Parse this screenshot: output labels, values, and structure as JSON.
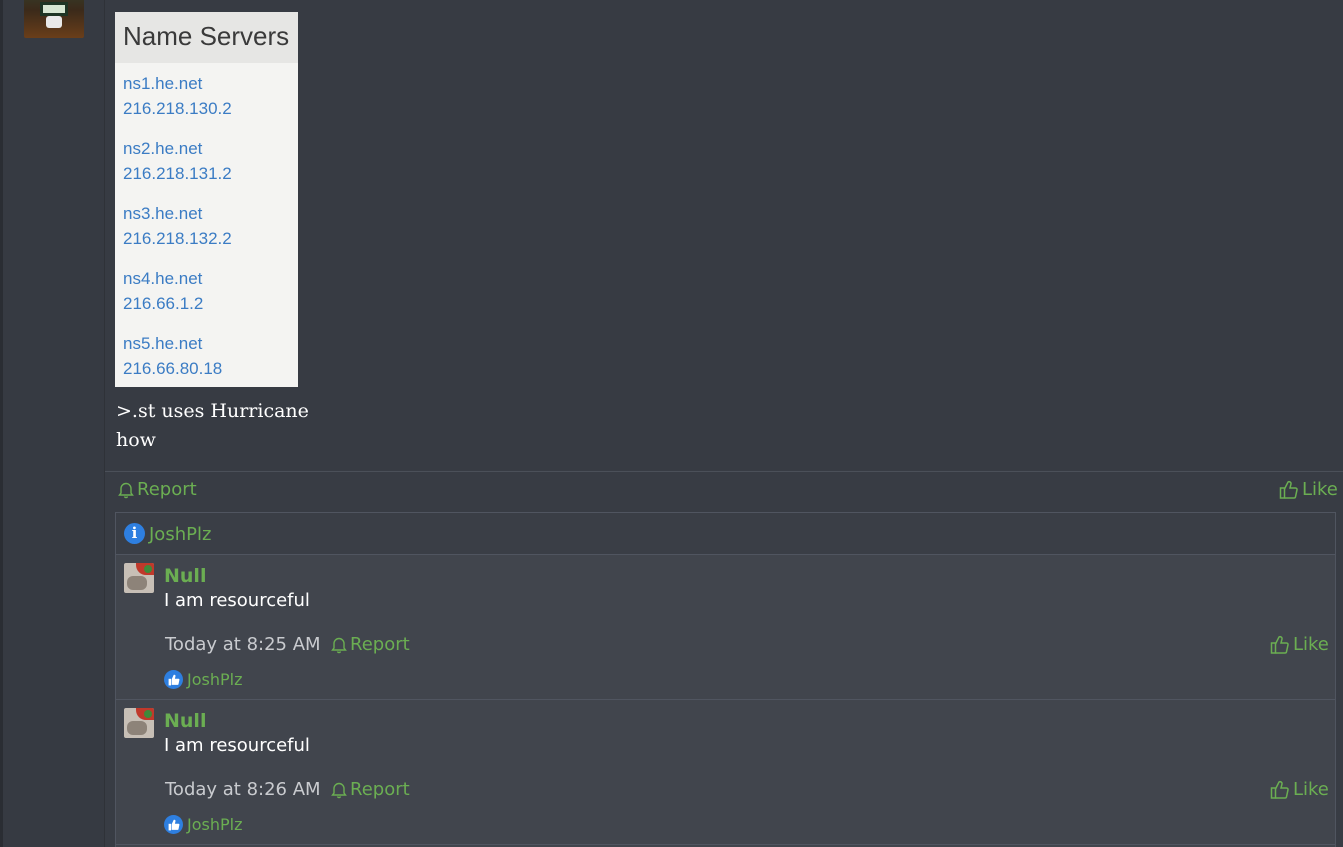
{
  "name_servers": {
    "header": "Name Servers",
    "entries": [
      {
        "host": "ns1.he.net",
        "ip": "216.218.130.2"
      },
      {
        "host": "ns2.he.net",
        "ip": "216.218.131.2"
      },
      {
        "host": "ns3.he.net",
        "ip": "216.218.132.2"
      },
      {
        "host": "ns4.he.net",
        "ip": "216.66.1.2"
      },
      {
        "host": "ns5.he.net",
        "ip": "216.66.80.18"
      }
    ]
  },
  "post": {
    "lines": [
      ">.st uses Hurricane",
      "how"
    ]
  },
  "post_actions": {
    "report_label": "Report",
    "like_label": "Like"
  },
  "thread": {
    "info_icon": "info-icon",
    "info_user": "JoshPlz",
    "replies": [
      {
        "author": "Null",
        "message": "I am resourceful",
        "time": "Today at 8:25 AM",
        "report_label": "Report",
        "like_label": "Like",
        "liked_by": "JoshPlz"
      },
      {
        "author": "Null",
        "message": "I am resourceful",
        "time": "Today at 8:26 AM",
        "report_label": "Report",
        "like_label": "Like",
        "liked_by": "JoshPlz"
      }
    ]
  },
  "colors": {
    "accent_green": "#6bae52",
    "link_blue": "#3b7cc4",
    "badge_blue": "#2e7fe0",
    "background": "#383c44"
  }
}
